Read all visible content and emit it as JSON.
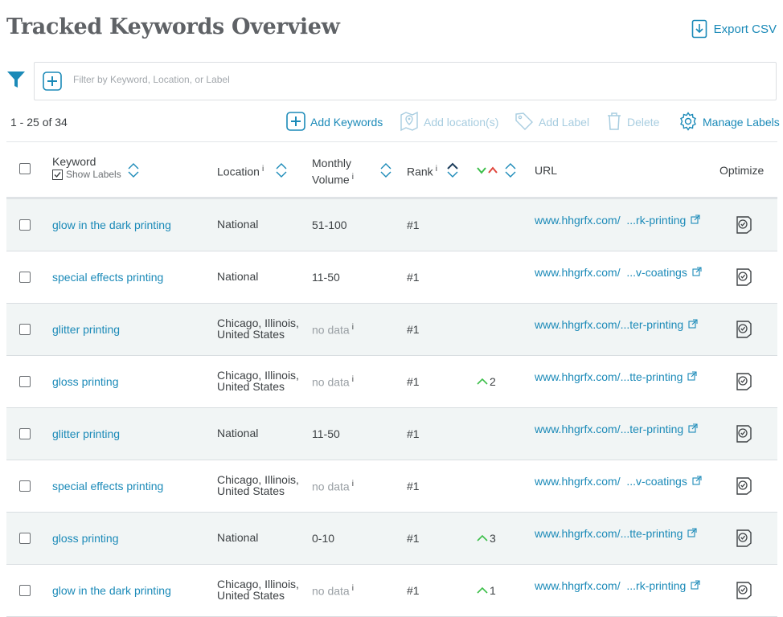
{
  "page": {
    "title": "Tracked Keywords Overview",
    "export_label": "Export CSV"
  },
  "filter": {
    "placeholder": "Filter by Keyword, Location, or Label"
  },
  "toolbar": {
    "count": "1 - 25 of 34",
    "add_keywords": "Add Keywords",
    "add_location": "Add location(s)",
    "add_label": "Add Label",
    "delete": "Delete",
    "manage_labels": "Manage Labels"
  },
  "table": {
    "headers": {
      "keyword": "Keyword",
      "show_labels": "Show Labels",
      "location": "Location",
      "monthly": "Monthly",
      "volume": "Volume",
      "rank": "Rank",
      "url": "URL",
      "optimize": "Optimize",
      "info_glyph": "i"
    },
    "rows": [
      {
        "keyword": "glow in the dark printing",
        "loc1": "National",
        "loc2": "",
        "volume": "51-100",
        "nodata": false,
        "rank": "#1",
        "change": "",
        "url": "www.hhgrfx.com/  ...rk-printing"
      },
      {
        "keyword": "special effects printing",
        "loc1": "National",
        "loc2": "",
        "volume": "11-50",
        "nodata": false,
        "rank": "#1",
        "change": "",
        "url": "www.hhgrfx.com/  ...v-coatings"
      },
      {
        "keyword": "glitter printing",
        "loc1": "Chicago, Illinois,",
        "loc2": "United States",
        "volume": "no data",
        "nodata": true,
        "rank": "#1",
        "change": "",
        "url": "www.hhgrfx.com/...ter-printing"
      },
      {
        "keyword": "gloss printing",
        "loc1": "Chicago, Illinois,",
        "loc2": "United States",
        "volume": "no data",
        "nodata": true,
        "rank": "#1",
        "change": "2",
        "url": "www.hhgrfx.com/...tte-printing"
      },
      {
        "keyword": "glitter printing",
        "loc1": "National",
        "loc2": "",
        "volume": "11-50",
        "nodata": false,
        "rank": "#1",
        "change": "",
        "url": "www.hhgrfx.com/...ter-printing"
      },
      {
        "keyword": "special effects printing",
        "loc1": "Chicago, Illinois,",
        "loc2": "United States",
        "volume": "no data",
        "nodata": true,
        "rank": "#1",
        "change": "",
        "url": "www.hhgrfx.com/  ...v-coatings"
      },
      {
        "keyword": "gloss printing",
        "loc1": "National",
        "loc2": "",
        "volume": "0-10",
        "nodata": false,
        "rank": "#1",
        "change": "3",
        "url": "www.hhgrfx.com/...tte-printing"
      },
      {
        "keyword": "glow in the dark printing",
        "loc1": "Chicago, Illinois,",
        "loc2": "United States",
        "volume": "no data",
        "nodata": true,
        "rank": "#1",
        "change": "1",
        "url": "www.hhgrfx.com/  ...rk-printing"
      }
    ]
  },
  "colors": {
    "accent": "#1b8ab8",
    "disabled": "#a8cde0",
    "up_green": "#3cbf4a",
    "down_red": "#e0463c",
    "row_alt": "#f1f5f5"
  }
}
